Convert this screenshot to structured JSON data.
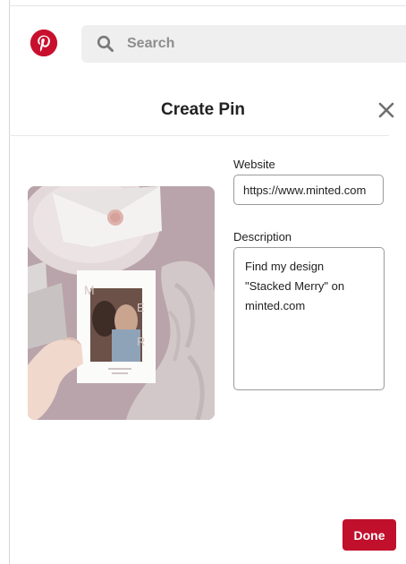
{
  "header": {
    "logo_icon": "pinterest-logo-icon",
    "brand_color": "#c8102e",
    "search": {
      "placeholder": "Search",
      "icon": "search-icon"
    }
  },
  "dialog": {
    "title": "Create Pin",
    "close_icon": "close-icon",
    "image": {
      "alt": "Wedding card photo with couple and pink wax seal envelope"
    },
    "website": {
      "label": "Website",
      "value": "https://www.minted.com"
    },
    "description": {
      "label": "Description",
      "value": "Find my design \"Stacked Merry\" on minted.com"
    },
    "done_label": "Done",
    "done_color": "#c0102c"
  }
}
